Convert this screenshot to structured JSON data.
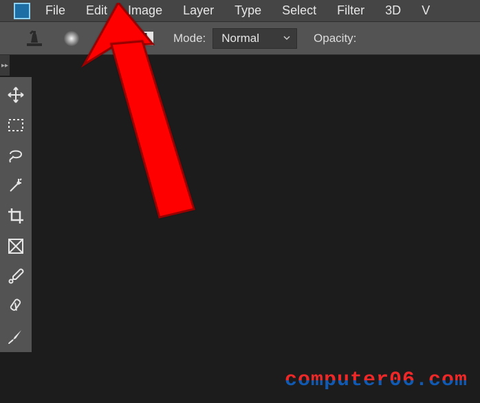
{
  "menubar": {
    "items": [
      {
        "label": "File"
      },
      {
        "label": "Edit"
      },
      {
        "label": "Image"
      },
      {
        "label": "Layer"
      },
      {
        "label": "Type"
      },
      {
        "label": "Select"
      },
      {
        "label": "Filter"
      },
      {
        "label": "3D"
      },
      {
        "label": "V"
      }
    ]
  },
  "optionsbar": {
    "mode_label": "Mode:",
    "mode_value": "Normal",
    "opacity_label": "Opacity:"
  },
  "watermark": "computer06.com",
  "arrow_target": "Edit"
}
